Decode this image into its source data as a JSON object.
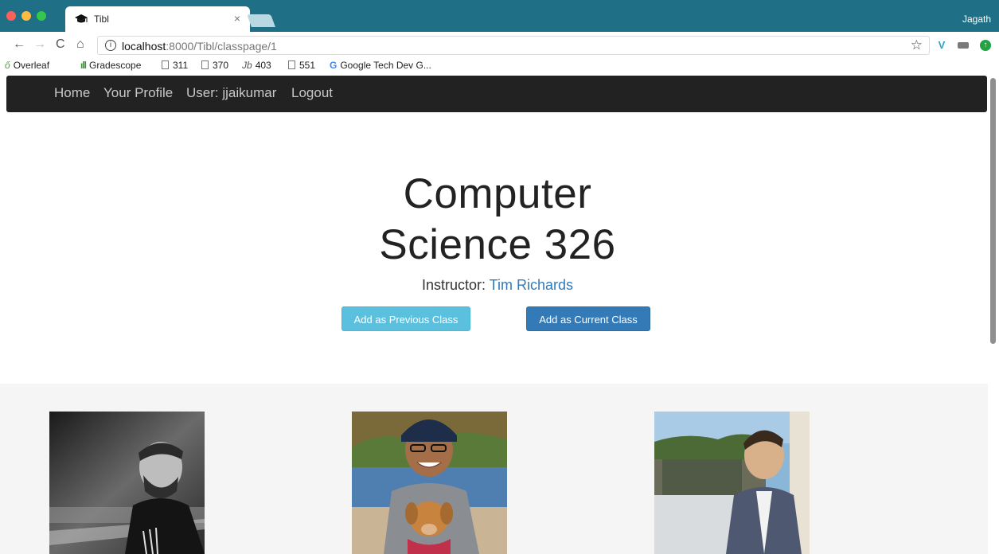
{
  "browser": {
    "tab_title": "Tibl",
    "tab_close": "×",
    "profile_name": "Jagath",
    "url_host": "localhost",
    "url_path": ":8000/Tibl/classpage/1",
    "info_glyph": "i",
    "star_glyph": "☆",
    "nav": {
      "back_glyph": "←",
      "forward_glyph": "→",
      "reload_glyph": "C",
      "home_glyph": "⌂"
    },
    "extensions": [
      {
        "name": "vimium-icon",
        "glyph": "V"
      },
      {
        "name": "tag-extension-icon",
        "glyph": ""
      },
      {
        "name": "green-extension-icon",
        "glyph": "↑"
      }
    ],
    "bookmarks": [
      {
        "label": "Overleaf",
        "icon": "overleaf-icon",
        "glyph": "ő"
      },
      {
        "label": "Gradescope",
        "icon": "gradescope-icon",
        "glyph": "ıll"
      },
      {
        "label": "311",
        "icon": "page-icon",
        "glyph": ""
      },
      {
        "label": "370",
        "icon": "page-icon",
        "glyph": ""
      },
      {
        "label": "403",
        "icon": "jb-icon",
        "glyph": "Jb"
      },
      {
        "label": "551",
        "icon": "page-icon",
        "glyph": ""
      },
      {
        "label": "Google Tech Dev G...",
        "icon": "google-icon",
        "glyph": "G"
      }
    ]
  },
  "page": {
    "nav_links": [
      "Home",
      "Your Profile",
      "User: jjaikumar",
      "Logout"
    ],
    "title_line1": "Computer",
    "title_line2": "Science 326",
    "instructor_label": "Instructor: ",
    "instructor_name": "Tim Richards",
    "buttons": {
      "previous": "Add as Previous Class",
      "current": "Add as Current Class"
    },
    "students": [
      {
        "photo": "student-photo-1"
      },
      {
        "photo": "student-photo-2"
      },
      {
        "photo": "student-photo-3"
      }
    ]
  },
  "colors": {
    "titlebar": "#1f6f86",
    "navbar": "#222222",
    "link": "#337ab7",
    "btn_info": "#5bc0de",
    "btn_primary": "#337ab7",
    "students_bg": "#f5f5f5"
  }
}
